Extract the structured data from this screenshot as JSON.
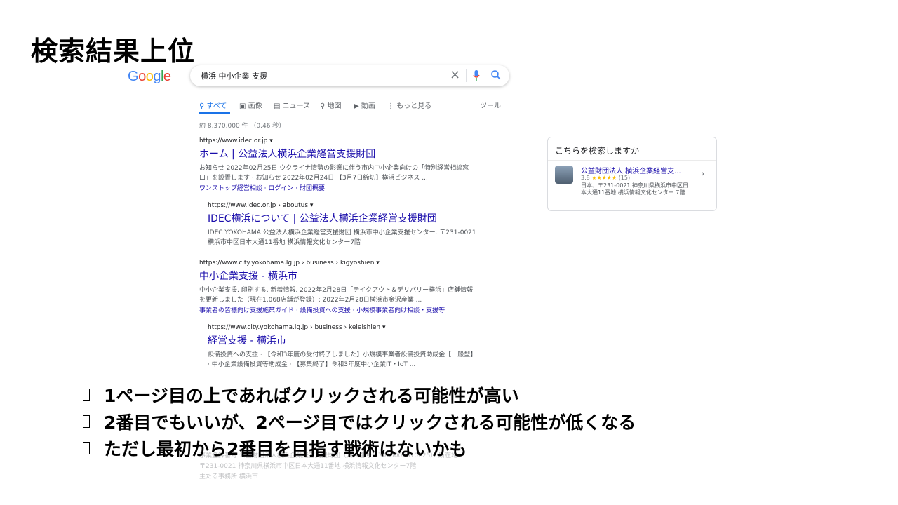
{
  "slide": {
    "title": "検索結果上位",
    "bullets": [
      "1ページ目の上であればクリックされる可能性が高い",
      "2番目でもいいが、2ページ目ではクリックされる可能性が低くなる",
      "ただし最初から2番目を目指す戦術はないかも"
    ]
  },
  "search": {
    "logo": [
      "G",
      "o",
      "o",
      "g",
      "l",
      "e"
    ],
    "query": "横浜 中小企業 支援",
    "tabs": [
      "すべて",
      "画像",
      "ニュース",
      "地図",
      "動画",
      "もっと見る"
    ],
    "tools": "ツール",
    "stats": "約 8,370,000 件 （0.46 秒）"
  },
  "results": [
    {
      "url": "https://www.idec.or.jp ▾",
      "title": "ホーム | 公益法人横浜企業経営支援財団",
      "snippet": [
        "お知らせ 2022年02月25日 ウクライナ情勢の影響に伴う市内中小企業向けの「特別経営相談窓",
        "口」を設置します · お知らせ 2022年02月24日 【3月7日締切】横浜ビジネス ..."
      ],
      "links": "ワンストップ経営相談 · ログイン · 財団概要"
    },
    {
      "url": "https://www.idec.or.jp › aboutus ▾",
      "title": "IDEC横浜について | 公益法人横浜企業経営支援財団",
      "snippet": [
        "IDEC YOKOHAMA 公益法人横浜企業経営支援財団 横浜市中小企業支援センター. 〒231-0021",
        "横浜市中区日本大通11番地 横浜情報文化センター7階"
      ]
    },
    {
      "url": "https://www.city.yokohama.lg.jp › business › kigyoshien ▾",
      "title": "中小企業支援 - 横浜市",
      "snippet": [
        "中小企業支援. 印刷する. 新着情報. 2022年2月28日「テイクアウト＆デリバリー横浜」店舗情報",
        "を更新しました（現在1,068店舗が登録）; 2022年2月28日横浜市金沢産業 ..."
      ],
      "links": "事業者の皆様向け支援施策ガイド · 設備投資への支援 · 小規模事業者向け相談・支援等"
    },
    {
      "url": "https://www.city.yokohama.lg.jp › business › keieishien ▾",
      "title": "経営支援 - 横浜市",
      "snippet": [
        "設備投資への支援 · 【令和3年度の受付終了しました】小規模事業者設備投資助成金【一般型】",
        "· 中小企業設備投資等助成金 · 【募集終了】令和3年度中小企業IT・IoT ..."
      ]
    }
  ],
  "knowledge_panel": {
    "heading": "こちらを検索しますか",
    "name": "公益財団法人 横浜企業経営支...",
    "rating_value": "3.8",
    "stars": "★★★★★",
    "reviews": "(15)",
    "address": "日本、〒231-0021 神奈川県横浜市中区日本大通11番地 横浜情報文化センター 7階"
  },
  "faded_lines": [
    "事業登録番号 公益財団法人横浜企業経営支援財団（法人番号：7020005010225） 所在地",
    "〒231-0021 神奈川県横浜市中区日本大通11番地 横浜情報文化センター7階",
    "主たる事務所 横浜市"
  ],
  "colors": {
    "link": "#1a0dab",
    "active_tab": "#1a73e8"
  }
}
